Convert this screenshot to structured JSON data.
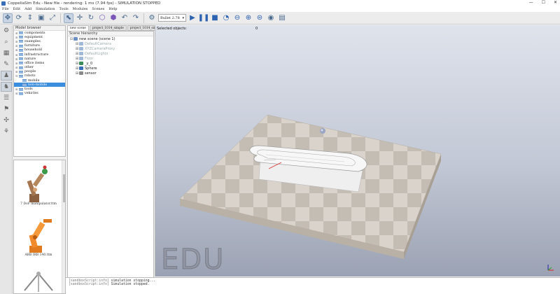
{
  "window": {
    "title": "CoppeliaSim Edu - New file - rendering: 1 ms (7.94 fps) - SIMULATION STOPPED",
    "controls": [
      "—",
      "☐",
      "✕"
    ]
  },
  "menu": [
    "File",
    "Edit",
    "Add",
    "Simulation",
    "Tools",
    "Modules",
    "Scenes",
    "Help"
  ],
  "toolbar": {
    "engine": "Bullet 2.78"
  },
  "model_browser": {
    "title": "Model browser",
    "items": [
      {
        "label": "components",
        "expanded": true
      },
      {
        "label": "equipment",
        "expanded": true
      },
      {
        "label": "examples",
        "expanded": true
      },
      {
        "label": "furniture",
        "expanded": true
      },
      {
        "label": "household",
        "expanded": true
      },
      {
        "label": "infrastructure",
        "expanded": true
      },
      {
        "label": "nature",
        "expanded": true
      },
      {
        "label": "office items",
        "expanded": true
      },
      {
        "label": "other",
        "expanded": true
      },
      {
        "label": "people",
        "expanded": true
      },
      {
        "label": "robots",
        "expanded": true
      },
      {
        "label": "mobile",
        "child": true
      },
      {
        "label": "non-mobile",
        "child": true,
        "selected": true
      },
      {
        "label": "tools",
        "expanded": true
      },
      {
        "label": "vehicles",
        "expanded": true
      }
    ],
    "thumbnails": [
      {
        "label": "7 DoF manipulator.ttm"
      },
      {
        "label": "ABB IRB 140.ttm"
      }
    ]
  },
  "scene_tabs": [
    "new scene",
    "project_1014_simple",
    "project_1014_simple"
  ],
  "hierarchy": {
    "title": "Scene hierarchy",
    "rows": [
      {
        "label": "new scene (scene 1)",
        "level": 0,
        "dim": false,
        "icon": "scene-icon",
        "color": "#6b8fc4"
      },
      {
        "label": "DefaultCamera",
        "level": 1,
        "dim": true,
        "icon": "camera-icon",
        "color": "#9fb8d8"
      },
      {
        "label": "XYZCameraProxy",
        "level": 1,
        "dim": true,
        "icon": "camera-icon",
        "color": "#9fb8d8"
      },
      {
        "label": "DefaultLights",
        "level": 1,
        "dim": true,
        "icon": "light-icon",
        "color": "#9fb8d8"
      },
      {
        "label": "Floor",
        "level": 1,
        "dim": true,
        "icon": "shape-icon",
        "color": "#9fb8d8"
      },
      {
        "label": "_y_0",
        "level": 1,
        "dim": false,
        "icon": "shape-icon",
        "color": "#3a8a5a"
      },
      {
        "label": "Sphere",
        "level": 1,
        "dim": false,
        "icon": "shape-icon",
        "color": "#3a6fb7"
      },
      {
        "label": "sensor",
        "level": 1,
        "dim": false,
        "icon": "sensor-icon",
        "color": "#888888"
      }
    ]
  },
  "viewport": {
    "selected_label": "Selected objects:",
    "selected_count": "0",
    "watermark": "EDU"
  },
  "console": [
    {
      "source": "[sandboxScript:info]",
      "text": "simulation stopping..."
    },
    {
      "source": "[sandboxScript:info]",
      "text": "Simulation stopped."
    }
  ]
}
